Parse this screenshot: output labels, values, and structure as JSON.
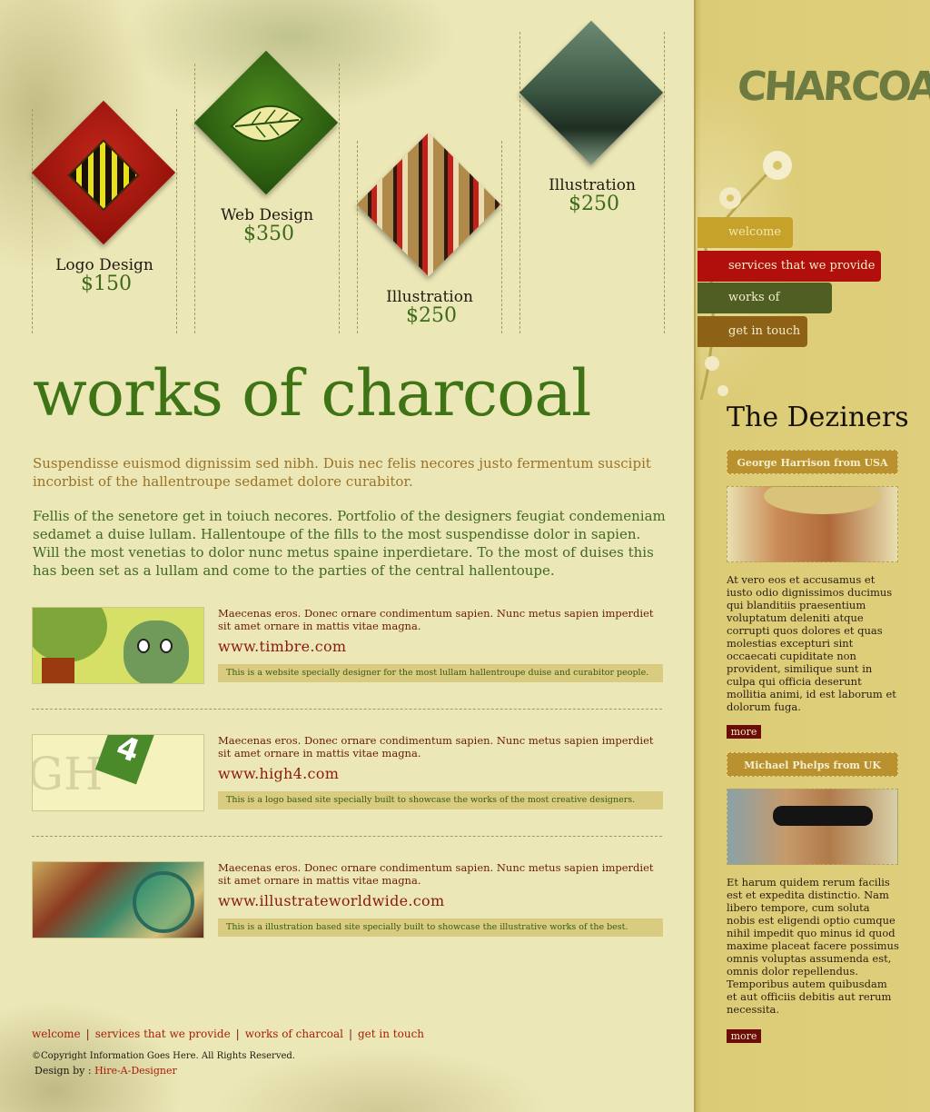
{
  "services": [
    {
      "name": "Logo Design",
      "price": "$150"
    },
    {
      "name": "Web Design",
      "price": "$350"
    },
    {
      "name": "Illustration",
      "price": "$250"
    },
    {
      "name": "Illustration",
      "price": "$250"
    }
  ],
  "main": {
    "title": "works of charcoal",
    "lead": "Suspendisse euismod dignissim sed nibh. Duis nec felis necores justo fermentum suscipit incorbist of the hallentroupe sedamet dolore curabitor.",
    "body": "Fellis of the senetore get in toiuch necores. Portfolio of the designers feugiat condemeniam sedamet a duise lullam. Hallentoupe of the fills to the most suspendisse dolor in sapien. Will the most venetias to dolor nunc metus spaine inperdietare. To the most of duises this has been set as a lullam and come to the parties of the central hallentoupe."
  },
  "works": [
    {
      "desc": "Maecenas eros. Donec ornare condimentum sapien. Nunc metus sapien imperdiet sit amet ornare in mattis vitae magna.",
      "link": "www.timbre.com",
      "note": "This is a website specially designer for the most lullam hallentroupe duise and curabitor people."
    },
    {
      "desc": "Maecenas eros. Donec ornare condimentum sapien. Nunc metus sapien imperdiet sit amet ornare in mattis vitae magna.",
      "link": "www.high4.com",
      "note": "This is a logo based site specially built to showcase the works of the most creative designers."
    },
    {
      "desc": "Maecenas eros. Donec ornare condimentum sapien. Nunc metus sapien imperdiet sit amet ornare in mattis vitae magna.",
      "link": "www.illustrateworldwide.com",
      "note": "This is a illustration based site specially built to showcase the illustrative works of the best."
    }
  ],
  "thumb_text": {
    "high4_letters": "GH",
    "high4_number": "4"
  },
  "footer": {
    "nav": [
      "welcome",
      "services that we provide",
      "works of charcoal",
      "get in touch"
    ],
    "copyright": "©Copyright Information Goes Here. All Rights Reserved.",
    "design_by_label": "Design by :",
    "design_by_link": "Hire-A-Designer"
  },
  "sidebar": {
    "logo": "CHARCOAL",
    "nav": [
      {
        "label": "welcome",
        "color": "#c7a22a"
      },
      {
        "label": "services that we provide",
        "color": "#b10f0b"
      },
      {
        "label": "works of charcoal",
        "color": "#4f5e23"
      },
      {
        "label": "get in touch",
        "color": "#8d6217"
      }
    ],
    "heading": "The Deziners",
    "people": [
      {
        "tag": "George Harrison from USA",
        "bio": "At vero eos et accusamus et iusto odio dignissimos ducimus qui blanditiis praesentium voluptatum deleniti atque corrupti quos dolores et quas molestias excepturi sint occaecati cupiditate non provident, similique sunt in culpa qui officia deserunt mollitia animi, id est laborum et dolorum fuga.",
        "more": "more"
      },
      {
        "tag": "Michael Phelps from UK",
        "bio": "Et harum quidem rerum facilis est et expedita distinctio. Nam libero tempore, cum soluta nobis est eligendi optio cumque nihil impedit quo minus id quod maxime placeat facere possimus omnis voluptas assumenda est, omnis dolor repellendus. Temporibus autem quibusdam et aut officiis debitis aut rerum necessita.",
        "more": "more"
      }
    ]
  }
}
